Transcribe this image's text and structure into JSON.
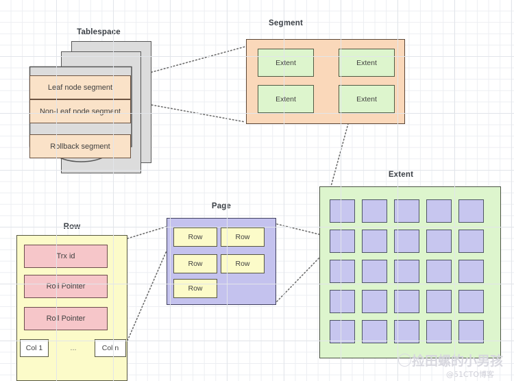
{
  "diagram": {
    "title_tablespace": "Tablespace",
    "title_segment": "Segment",
    "title_extent": "Extent",
    "title_page": "Page",
    "title_row": "Row"
  },
  "tablespace": {
    "segments": [
      {
        "label": "Leaf node segment"
      },
      {
        "label": "Non-Leaf node segment"
      },
      {
        "label": "Rollback  segment"
      }
    ],
    "sheet_count": 3
  },
  "segment": {
    "extents": [
      {
        "label": "Extent"
      },
      {
        "label": "Extent"
      },
      {
        "label": "Extent"
      },
      {
        "label": "Extent"
      }
    ]
  },
  "extent": {
    "rows": 5,
    "cols": 5,
    "page_cell_count": 25
  },
  "page": {
    "rows": [
      {
        "label": "Row"
      },
      {
        "label": "Row"
      },
      {
        "label": "Row"
      },
      {
        "label": "Row"
      },
      {
        "label": "Row"
      }
    ]
  },
  "row": {
    "fields": [
      {
        "label": "Trx id"
      },
      {
        "label": "Roll Pointer"
      },
      {
        "label": "Roll Pointer"
      }
    ],
    "col_first": "Col 1",
    "col_ellipsis": "...",
    "col_last": "Col n"
  },
  "watermark": {
    "name": "捡田螺的小男孩",
    "source": "@51CTO博客"
  },
  "colors": {
    "segment_fill": "#fae2c8",
    "segment_box_fill": "#fad8ba",
    "extent_fill": "#ddf5cd",
    "page_fill": "#c4c2ee",
    "page_cell_fill": "#c7c6ef",
    "row_fill": "#fcfbc9",
    "row_field_fill": "#f6c6c9",
    "sheet_fill": "#dcdcdc",
    "grid_line": "#e2e5ea",
    "connector": "#6b6b6b"
  }
}
